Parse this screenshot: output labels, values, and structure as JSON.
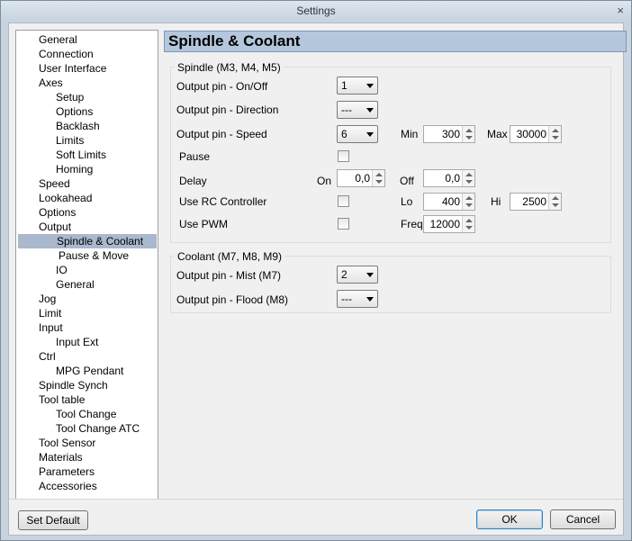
{
  "window": {
    "title": "Settings",
    "close_icon": "×"
  },
  "tree": {
    "items": [
      {
        "label": "General",
        "level": 1
      },
      {
        "label": "Connection",
        "level": 1
      },
      {
        "label": "User Interface",
        "level": 1
      },
      {
        "label": "Axes",
        "level": 1
      },
      {
        "label": "Setup",
        "level": 2
      },
      {
        "label": "Options",
        "level": 2
      },
      {
        "label": "Backlash",
        "level": 2
      },
      {
        "label": "Limits",
        "level": 2
      },
      {
        "label": "Soft Limits",
        "level": 2
      },
      {
        "label": "Homing",
        "level": 2
      },
      {
        "label": "Speed",
        "level": 1
      },
      {
        "label": "Lookahead",
        "level": 1
      },
      {
        "label": "Options",
        "level": 1
      },
      {
        "label": "Output",
        "level": 1
      },
      {
        "label": "Spindle & Coolant",
        "level": 2,
        "selected": true
      },
      {
        "label": "Pause & Move",
        "level": 2
      },
      {
        "label": "IO",
        "level": 2
      },
      {
        "label": "General",
        "level": 2
      },
      {
        "label": "Jog",
        "level": 1
      },
      {
        "label": "Limit",
        "level": 1
      },
      {
        "label": "Input",
        "level": 1
      },
      {
        "label": "Input Ext",
        "level": 2
      },
      {
        "label": "Ctrl",
        "level": 1
      },
      {
        "label": "MPG Pendant",
        "level": 2
      },
      {
        "label": "Spindle Synch",
        "level": 1
      },
      {
        "label": "Tool table",
        "level": 1
      },
      {
        "label": "Tool Change",
        "level": 2
      },
      {
        "label": "Tool Change ATC",
        "level": 2
      },
      {
        "label": "Tool Sensor",
        "level": 1
      },
      {
        "label": "Materials",
        "level": 1
      },
      {
        "label": "Parameters",
        "level": 1
      },
      {
        "label": "Accessories",
        "level": 1
      }
    ]
  },
  "panel": {
    "title": "Spindle & Coolant",
    "spindle": {
      "group_title": "Spindle (M3, M4, M5)",
      "onoff_label": "Output pin - On/Off",
      "onoff_value": "1",
      "direction_label": "Output pin - Direction",
      "direction_value": "---",
      "speed_label": "Output pin - Speed",
      "speed_value": "6",
      "min_label": "Min",
      "min_value": "300",
      "max_label": "Max",
      "max_value": "30000",
      "pause_label": "Pause",
      "delay_label": "Delay",
      "on_label": "On",
      "on_value": "0,0",
      "off_label": "Off",
      "off_value": "0,0",
      "rc_label": "Use RC Controller",
      "lo_label": "Lo",
      "lo_value": "400",
      "hi_label": "Hi",
      "hi_value": "2500",
      "pwm_label": "Use PWM",
      "freq_label": "Freq",
      "freq_value": "12000"
    },
    "coolant": {
      "group_title": "Coolant (M7, M8, M9)",
      "mist_label": "Output pin - Mist (M7)",
      "mist_value": "2",
      "flood_label": "Output pin - Flood (M8)",
      "flood_value": "---"
    }
  },
  "footer": {
    "set_default": "Set Default",
    "ok": "OK",
    "cancel": "Cancel"
  }
}
